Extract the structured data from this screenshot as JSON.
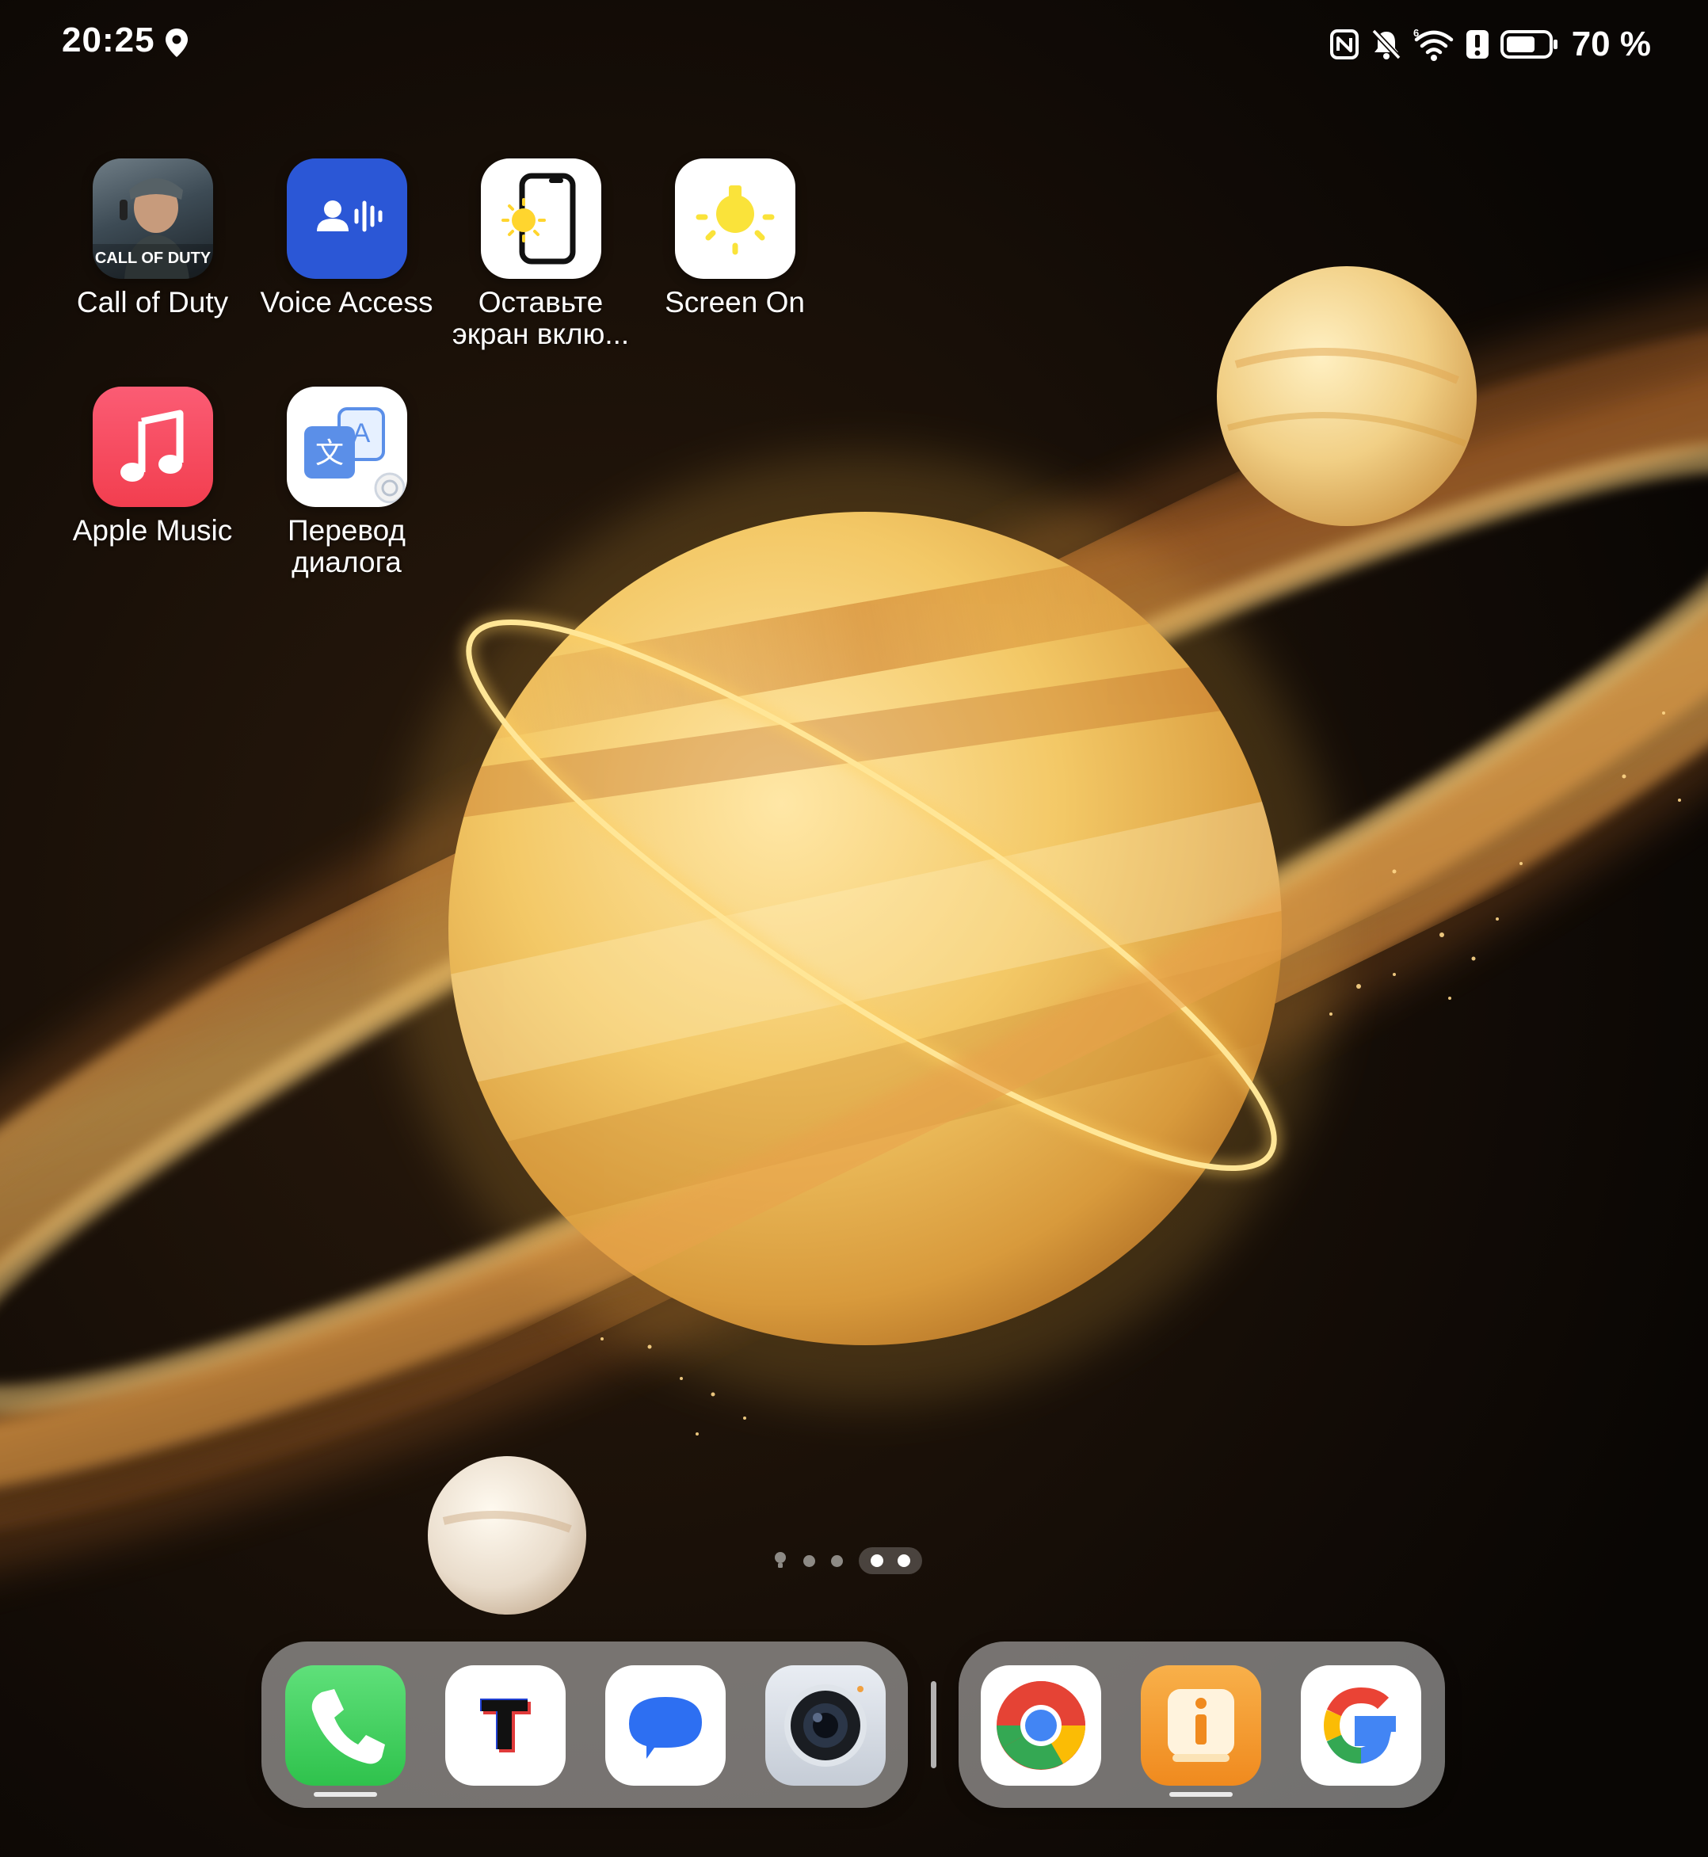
{
  "status_bar": {
    "time": "20:25",
    "battery_percent_text": "70 %",
    "battery_level": 0.7,
    "icons": [
      "location-icon",
      "nfc-icon",
      "bell-muted-icon",
      "wifi-icon",
      "alert-icon",
      "battery-icon"
    ]
  },
  "apps": [
    {
      "name": "Call of Duty",
      "label_line1": "Call of Duty",
      "label_line2": "",
      "icon": "call-of-duty-icon"
    },
    {
      "name": "Voice Access",
      "label_line1": "Voice Access",
      "label_line2": "",
      "icon": "voice-access-icon"
    },
    {
      "name": "Оставьте экран включённым",
      "label_line1": "Оставьте",
      "label_line2": "экран вклю...",
      "icon": "keep-screen-on-icon"
    },
    {
      "name": "Screen On",
      "label_line1": "Screen On",
      "label_line2": "",
      "icon": "screen-on-bulb-icon"
    },
    {
      "name": "Apple Music",
      "label_line1": "Apple Music",
      "label_line2": "",
      "icon": "music-note-icon"
    },
    {
      "name": "Перевод диалога",
      "label_line1": "Перевод",
      "label_line2": "диалога",
      "icon": "translate-icon"
    }
  ],
  "call_of_duty_logo_text": "CALL OF DUTY",
  "page_indicator": {
    "pages": 5,
    "current_pages": [
      4,
      5
    ],
    "first_page_icon": "bulb-small-icon"
  },
  "dock": {
    "left": [
      {
        "name": "Phone",
        "icon": "phone-icon",
        "running": true
      },
      {
        "name": "T-Bank",
        "icon": "t-logo-icon",
        "running": false
      },
      {
        "name": "Messages",
        "icon": "chat-bubble-icon",
        "running": false
      },
      {
        "name": "Camera",
        "icon": "camera-icon",
        "running": false
      }
    ],
    "right": [
      {
        "name": "Chrome",
        "icon": "chrome-icon",
        "running": false
      },
      {
        "name": "Info",
        "icon": "info-i-icon",
        "running": true
      },
      {
        "name": "Google",
        "icon": "google-g-icon",
        "running": false
      }
    ]
  },
  "colors": {
    "background": "#0d0805",
    "planet_gold": "#f3c866",
    "voice_access_blue": "#2b57d6",
    "apple_music_red": "#f23e4f",
    "phone_green": "#3fcf5a",
    "info_orange": "#f39a2e"
  }
}
